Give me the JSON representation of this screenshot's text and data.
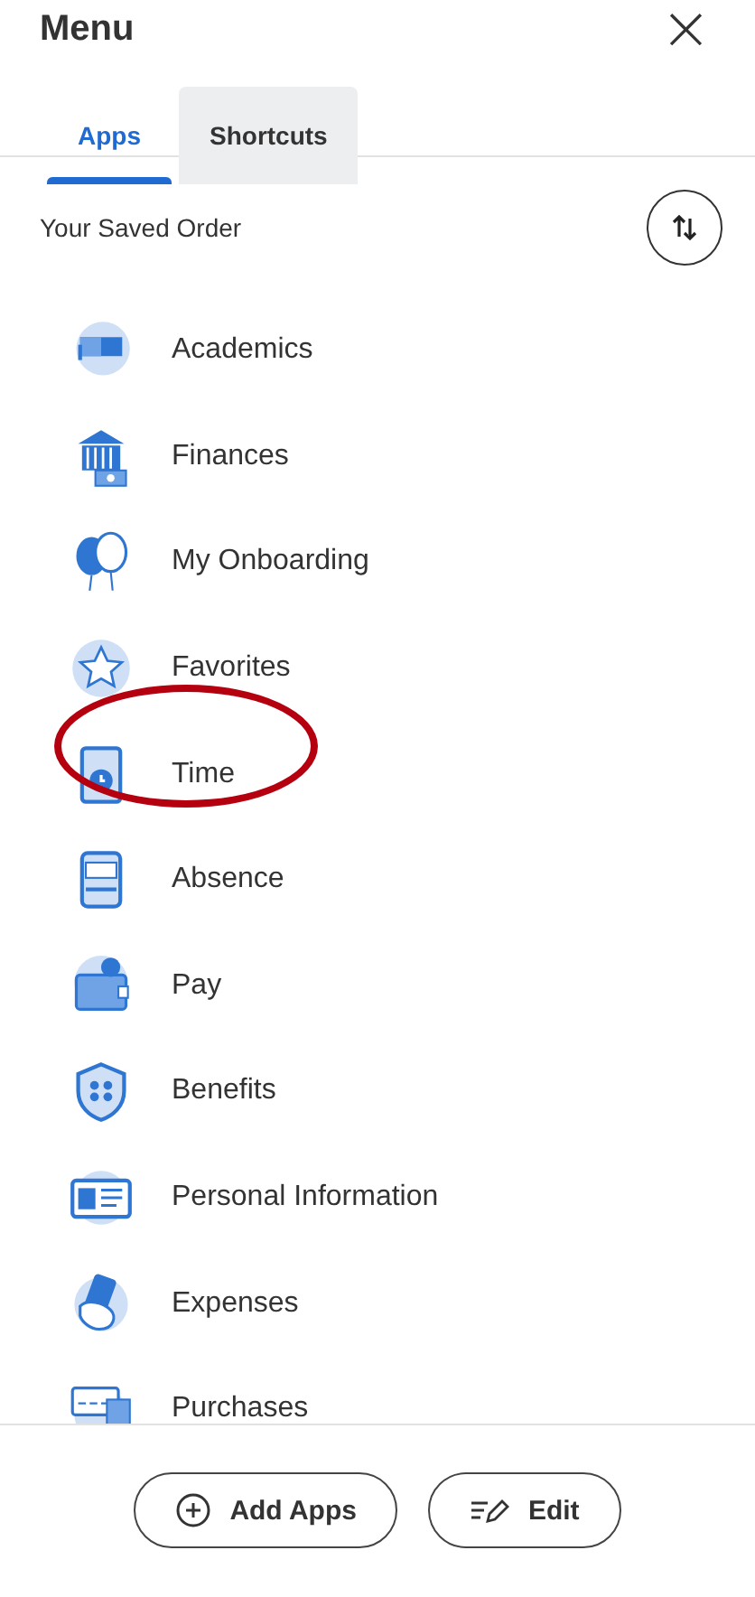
{
  "header": {
    "title": "Menu",
    "close": "×"
  },
  "tabs": [
    {
      "label": "Apps",
      "selected": true
    },
    {
      "label": "Shortcuts",
      "selected": false
    }
  ],
  "section": {
    "title": "Your Saved Order"
  },
  "apps": [
    {
      "label": "Academics",
      "circled": false
    },
    {
      "label": "Finances",
      "circled": false
    },
    {
      "label": "My Onboarding",
      "circled": false
    },
    {
      "label": "Favorites",
      "circled": false
    },
    {
      "label": "Time",
      "circled": true
    },
    {
      "label": "Absence",
      "circled": false
    },
    {
      "label": "Pay",
      "circled": false
    },
    {
      "label": "Benefits",
      "circled": false
    },
    {
      "label": "Personal Information",
      "circled": false
    },
    {
      "label": "Expenses",
      "circled": false
    },
    {
      "label": "Purchases",
      "circled": false
    }
  ],
  "footer": {
    "buttons": [
      {
        "label": "Add Apps",
        "kind": "add"
      },
      {
        "label": "Edit",
        "kind": "edit"
      }
    ]
  }
}
